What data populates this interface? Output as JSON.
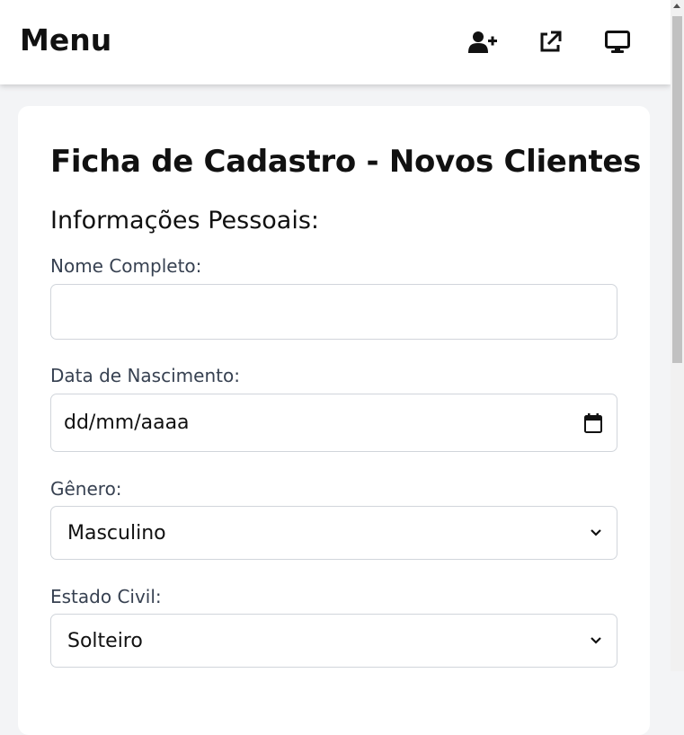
{
  "header": {
    "title": "Menu",
    "icons": [
      "add-user-icon",
      "external-link-icon",
      "monitor-icon"
    ]
  },
  "form": {
    "title": "Ficha de Cadastro - Novos Clientes",
    "section_personal": "Informações Pessoais:",
    "full_name": {
      "label": "Nome Completo:",
      "value": ""
    },
    "birth_date": {
      "label": "Data de Nascimento:",
      "placeholder": "dd/mm/aaaa",
      "icon": "calendar-icon"
    },
    "gender": {
      "label": "Gênero:",
      "selected": "Masculino"
    },
    "marital_status": {
      "label": "Estado Civil:",
      "selected": "Solteiro"
    }
  },
  "colors": {
    "background": "#f3f4f6",
    "card": "#ffffff",
    "border": "#d1d5db",
    "label": "#374151"
  }
}
